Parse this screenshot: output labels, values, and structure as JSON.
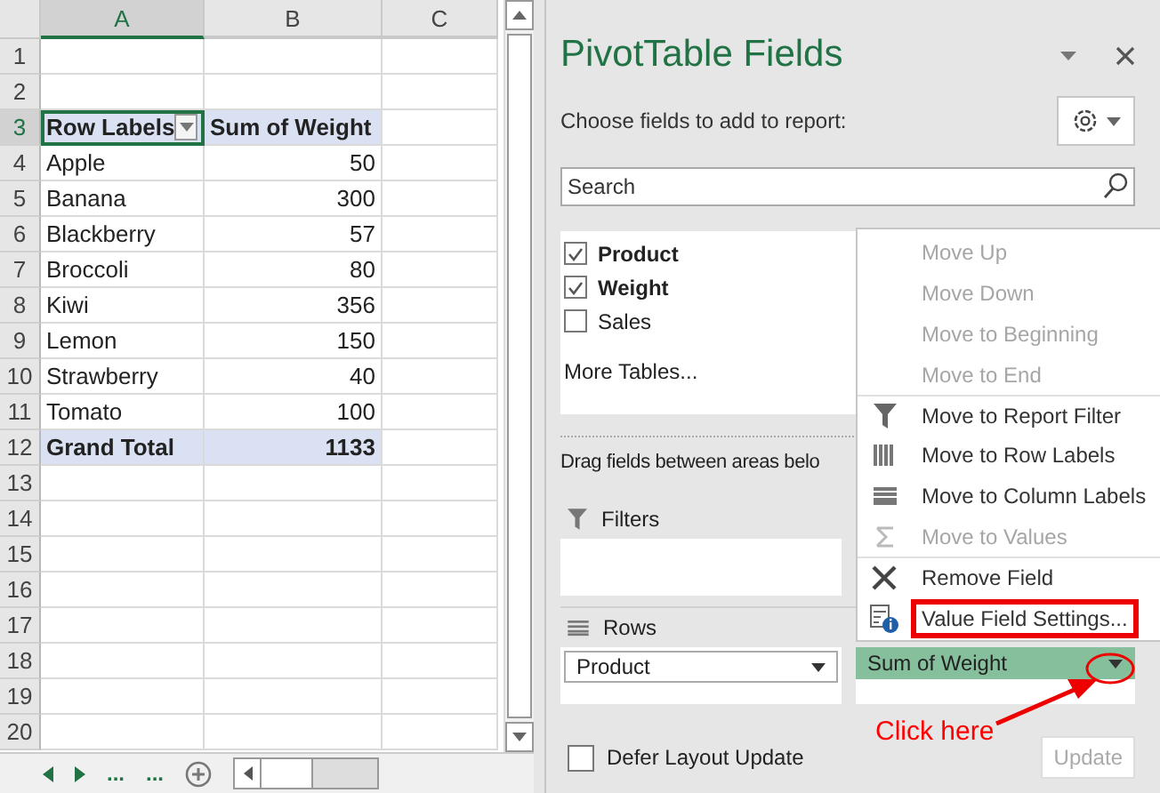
{
  "sheet": {
    "columns": [
      {
        "label": "A",
        "selected": true
      },
      {
        "label": "B",
        "selected": false
      },
      {
        "label": "C",
        "selected": false
      }
    ],
    "rows": [
      {
        "number": "1",
        "kind": "empty",
        "selected": false
      },
      {
        "number": "2",
        "kind": "empty",
        "selected": false
      },
      {
        "number": "3",
        "kind": "header",
        "selected": true,
        "label": "Row Labels",
        "value": "Sum of Weight"
      },
      {
        "number": "4",
        "kind": "data",
        "selected": false,
        "label": "Apple",
        "value": "50"
      },
      {
        "number": "5",
        "kind": "data",
        "selected": false,
        "label": "Banana",
        "value": "300"
      },
      {
        "number": "6",
        "kind": "data",
        "selected": false,
        "label": "Blackberry",
        "value": "57"
      },
      {
        "number": "7",
        "kind": "data",
        "selected": false,
        "label": "Broccoli",
        "value": "80"
      },
      {
        "number": "8",
        "kind": "data",
        "selected": false,
        "label": "Kiwi",
        "value": "356"
      },
      {
        "number": "9",
        "kind": "data",
        "selected": false,
        "label": "Lemon",
        "value": "150"
      },
      {
        "number": "10",
        "kind": "data",
        "selected": false,
        "label": "Strawberry",
        "value": "40"
      },
      {
        "number": "11",
        "kind": "data",
        "selected": false,
        "label": "Tomato",
        "value": "100"
      },
      {
        "number": "12",
        "kind": "total",
        "selected": false,
        "label": "Grand Total",
        "value": "1133"
      },
      {
        "number": "13",
        "kind": "empty",
        "selected": false
      },
      {
        "number": "14",
        "kind": "empty",
        "selected": false
      },
      {
        "number": "15",
        "kind": "empty",
        "selected": false
      },
      {
        "number": "16",
        "kind": "empty",
        "selected": false
      },
      {
        "number": "17",
        "kind": "empty",
        "selected": false
      },
      {
        "number": "18",
        "kind": "empty",
        "selected": false
      },
      {
        "number": "19",
        "kind": "empty",
        "selected": false
      },
      {
        "number": "20",
        "kind": "empty",
        "selected": false
      }
    ],
    "tab_bar": {
      "left_more": "...",
      "right_more": "..."
    }
  },
  "panel": {
    "title": "PivotTable Fields",
    "subtitle": "Choose fields to add to report:",
    "search": {
      "placeholder": "Search"
    },
    "fields": [
      {
        "label": "Product",
        "checked": true
      },
      {
        "label": "Weight",
        "checked": true
      },
      {
        "label": "Sales",
        "checked": false
      }
    ],
    "more_tables": "More Tables...",
    "drag_hint": "Drag fields between areas belo",
    "filters": {
      "label": "Filters"
    },
    "rows_area": {
      "label": "Rows",
      "items": [
        "Product"
      ]
    },
    "values_area": {
      "items": [
        "Sum of Weight"
      ]
    },
    "defer": {
      "label": "Defer Layout Update",
      "checked": false
    },
    "update_button": {
      "label": "Update",
      "disabled": true
    }
  },
  "context_menu": [
    {
      "label": "Move Up",
      "disabled": true,
      "kind": "plain",
      "boxed": false,
      "separator": false
    },
    {
      "label": "Move Down",
      "disabled": true,
      "kind": "plain",
      "boxed": false,
      "separator": false
    },
    {
      "label": "Move to Beginning",
      "disabled": true,
      "kind": "plain",
      "boxed": false,
      "separator": false
    },
    {
      "label": "Move to End",
      "disabled": true,
      "kind": "plain",
      "boxed": false,
      "separator": false
    },
    {
      "label": "Move to Report Filter",
      "disabled": false,
      "kind": "filter",
      "boxed": false,
      "separator": true
    },
    {
      "label": "Move to Row Labels",
      "disabled": false,
      "kind": "rows",
      "boxed": false,
      "separator": false
    },
    {
      "label": "Move to Column Labels",
      "disabled": false,
      "kind": "columns",
      "boxed": false,
      "separator": false
    },
    {
      "label": "Move to Values",
      "disabled": true,
      "kind": "sigma",
      "boxed": false,
      "separator": false
    },
    {
      "label": "Remove Field",
      "disabled": false,
      "kind": "remove",
      "boxed": false,
      "separator": true
    },
    {
      "label": "Value Field Settings...",
      "disabled": false,
      "kind": "settings",
      "boxed": true,
      "separator": false
    }
  ],
  "callout": {
    "text": "Click here"
  }
}
